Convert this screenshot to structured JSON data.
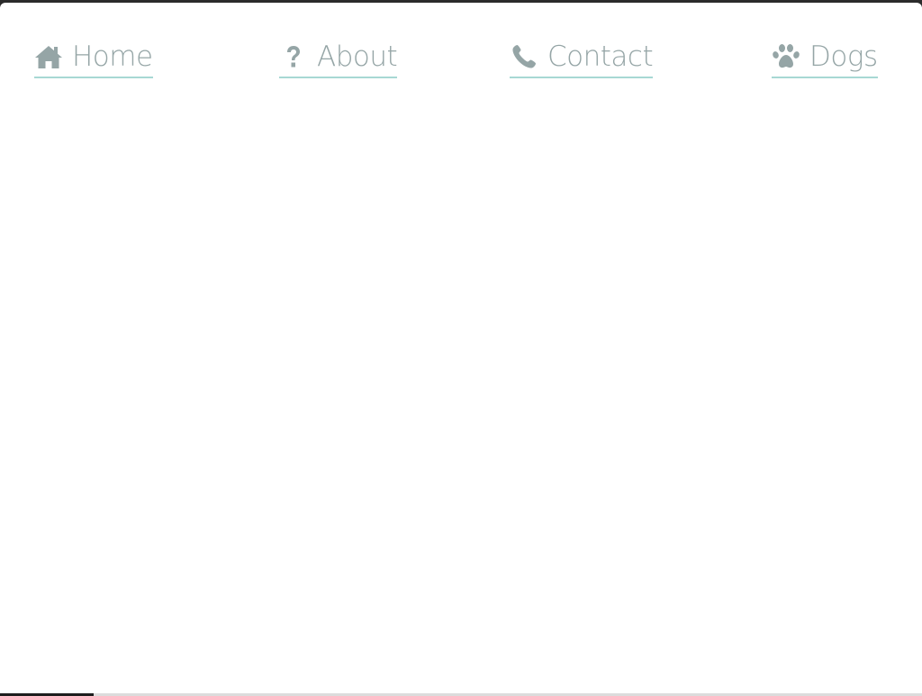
{
  "nav": {
    "items": [
      {
        "label": "Home",
        "icon": "home-icon"
      },
      {
        "label": "About",
        "icon": "question-icon"
      },
      {
        "label": "Contact",
        "icon": "phone-icon"
      },
      {
        "label": "Dogs",
        "icon": "paw-icon"
      }
    ]
  },
  "colors": {
    "link_text": "#95a5a6",
    "link_underline": "#a7d8d4",
    "background": "#ffffff"
  }
}
